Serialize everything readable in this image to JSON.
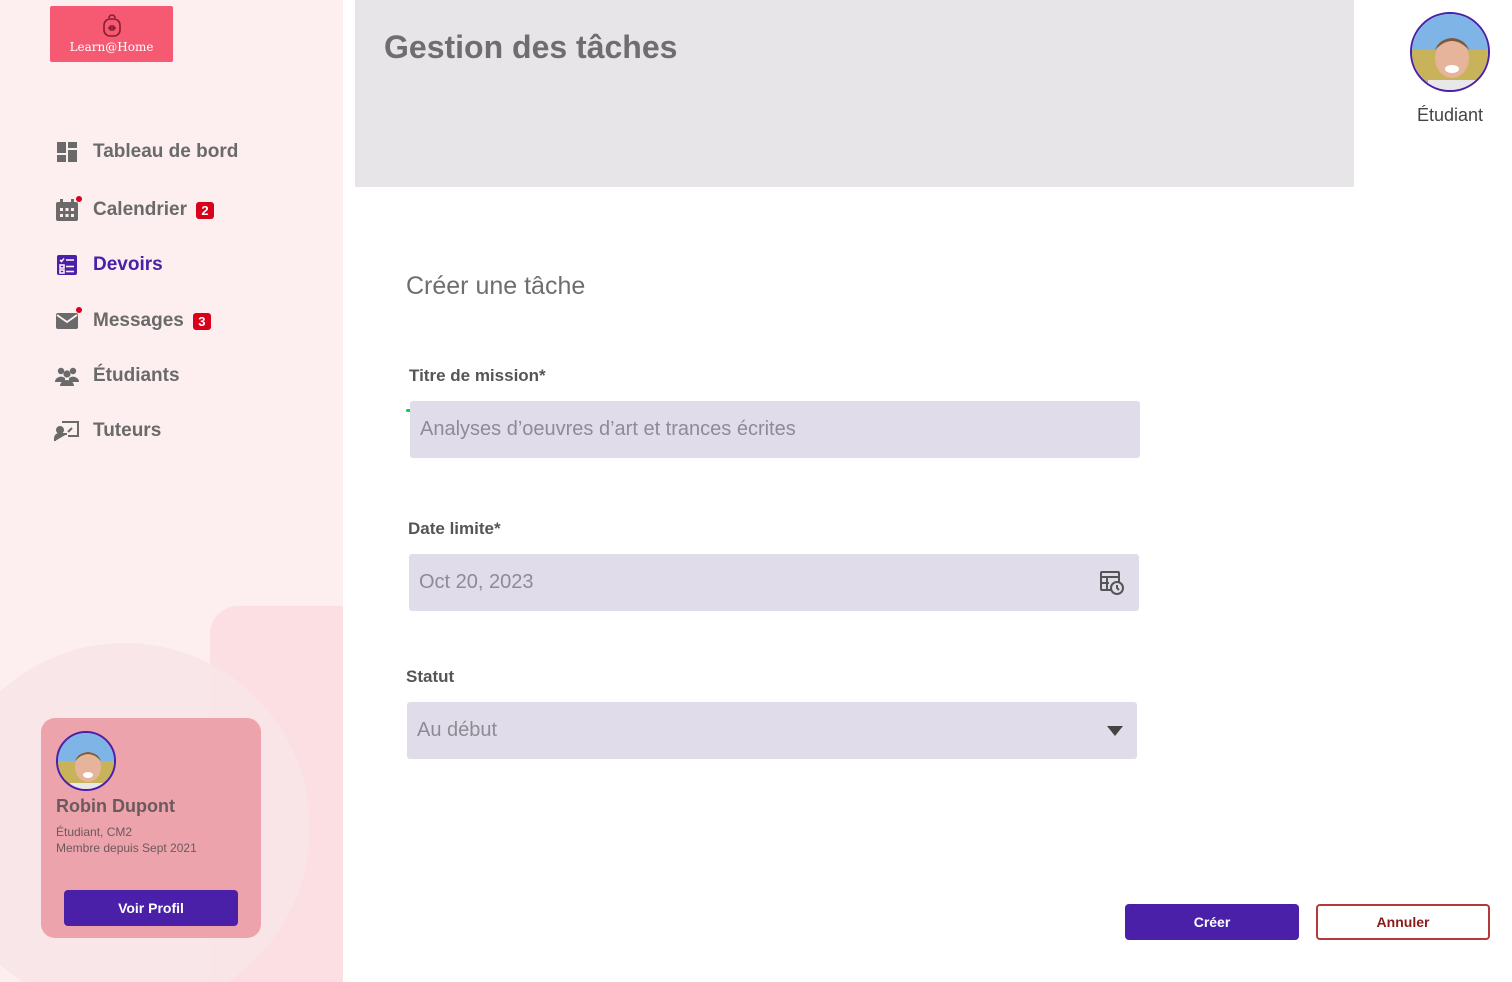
{
  "app": {
    "logo_text": "Learn@Home",
    "brand_color": "#f65a72",
    "accent_color": "#4a20a8"
  },
  "sidebar": {
    "items": [
      {
        "label": "Tableau de bord",
        "icon": "dashboard-icon",
        "active": false
      },
      {
        "label": "Calendrier",
        "icon": "calendar-icon",
        "badge": "2",
        "active": false
      },
      {
        "label": "Devoirs",
        "icon": "homework-icon",
        "active": true
      },
      {
        "label": "Messages",
        "icon": "mail-icon",
        "badge": "3",
        "active": false
      },
      {
        "label": "Étudiants",
        "icon": "students-icon",
        "active": false
      },
      {
        "label": "Tuteurs",
        "icon": "tutor-icon",
        "active": false
      }
    ],
    "profile": {
      "name": "Robin Dupont",
      "line1": "Étudiant, CM2",
      "line2": "Membre depuis Sept 2021",
      "button_label": "Voir Profil"
    }
  },
  "header": {
    "title": "Gestion des tâches",
    "user_role": "Étudiant"
  },
  "form": {
    "title": "Créer une tâche",
    "mission_label": "Titre de mission*",
    "mission_value": "Analyses d’oeuvres d’art et trances écrites",
    "date_label": "Date limite*",
    "date_value": "Oct 20, 2023",
    "status_label": "Statut",
    "status_value": "Au début",
    "create_label": "Créer",
    "cancel_label": "Annuler"
  }
}
